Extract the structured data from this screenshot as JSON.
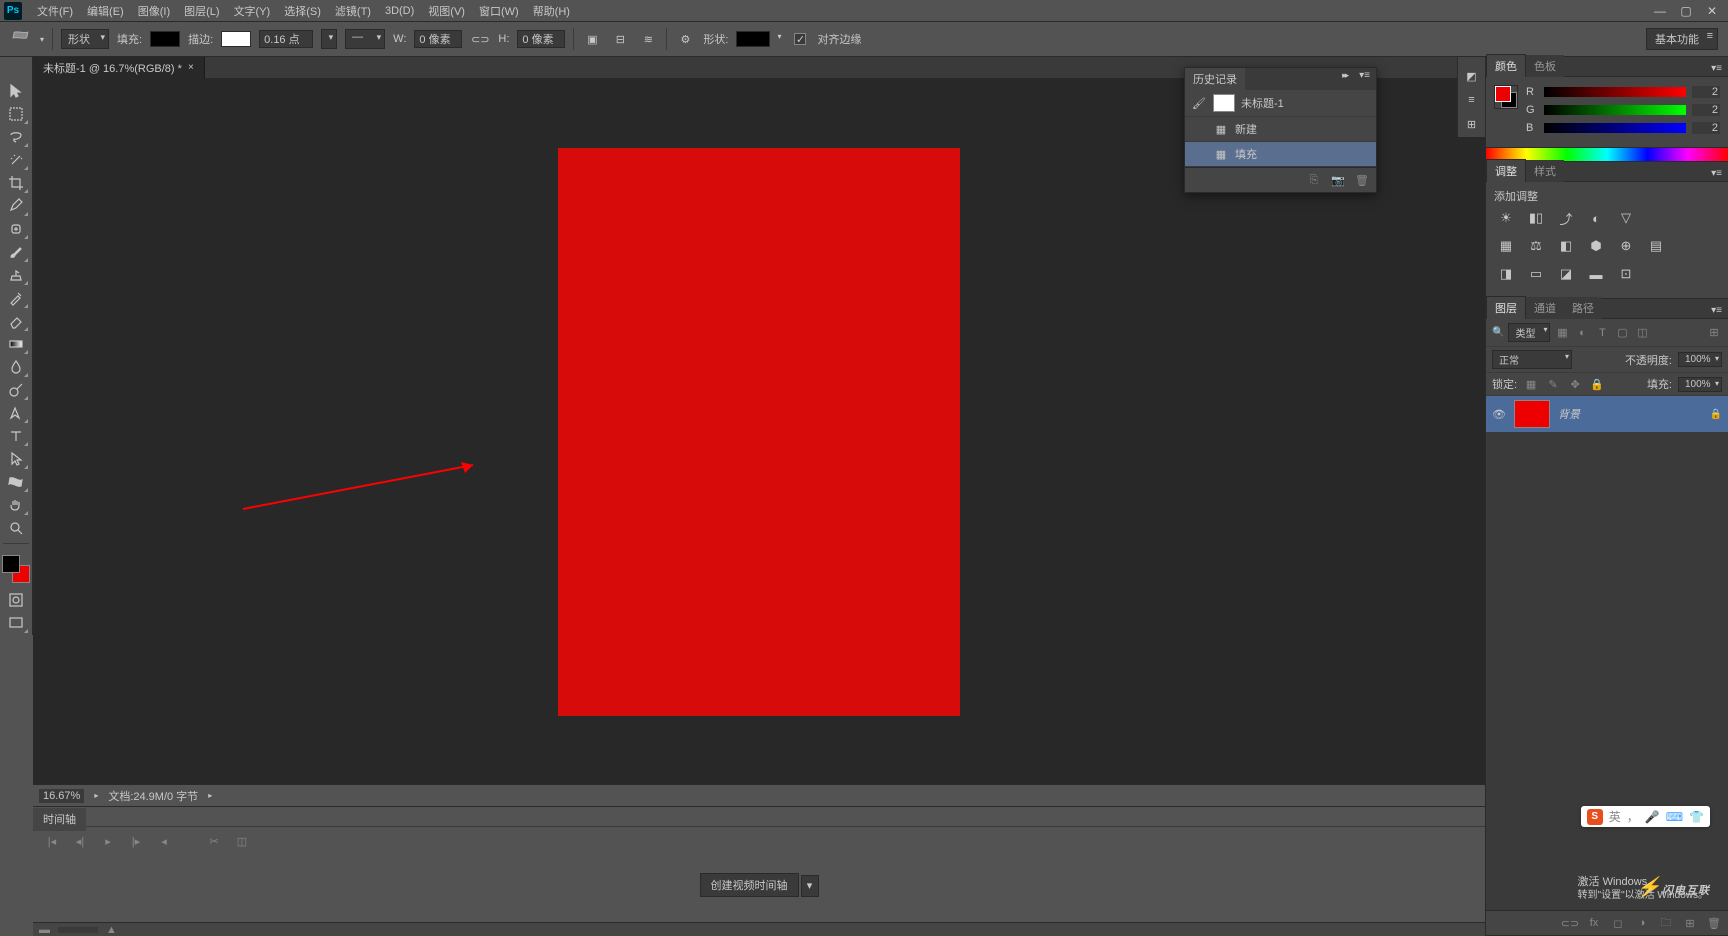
{
  "menubar": {
    "items": [
      "文件(F)",
      "编辑(E)",
      "图像(I)",
      "图层(L)",
      "文字(Y)",
      "选择(S)",
      "滤镜(T)",
      "3D(D)",
      "视图(V)",
      "窗口(W)",
      "帮助(H)"
    ]
  },
  "options": {
    "shape_mode": "形状",
    "fill_label": "填充:",
    "stroke_label": "描边:",
    "stroke_width": "0.16 点",
    "w_label": "W:",
    "w_value": "0 像素",
    "h_label": "H:",
    "h_value": "0 像素",
    "shape_label": "形状:",
    "align_edges": "对齐边缘",
    "workspace": "基本功能"
  },
  "doc_tab": "未标题-1 @ 16.7%(RGB/8) *",
  "status": {
    "zoom": "16.67%",
    "doc_info": "文档:24.9M/0 字节"
  },
  "timeline": {
    "tab": "时间轴",
    "create_btn": "创建视频时间轴"
  },
  "history": {
    "title": "历史记录",
    "doc_name": "未标题-1",
    "items": [
      "新建",
      "填充"
    ]
  },
  "panels": {
    "color_tab": "颜色",
    "swatches_tab": "色板",
    "r_label": "R",
    "g_label": "G",
    "b_label": "B",
    "r_val": "2",
    "g_val": "2",
    "b_val": "2",
    "adjust_tab": "调整",
    "styles_tab": "样式",
    "add_adjust": "添加调整",
    "layers_tab": "图层",
    "channels_tab": "通道",
    "paths_tab": "路径",
    "kind_filter": "类型",
    "blend_mode": "正常",
    "opacity_label": "不透明度:",
    "opacity_val": "100%",
    "lock_label": "锁定:",
    "fill_label": "填充:",
    "fill_val": "100%",
    "layer_name": "背景"
  },
  "watermark": {
    "line1": "激活 Windows",
    "line2": "转到\"设置\"以激活 Windows。",
    "brand": "闪电互联"
  },
  "ime": {
    "lang": "英",
    "sep": "，"
  }
}
